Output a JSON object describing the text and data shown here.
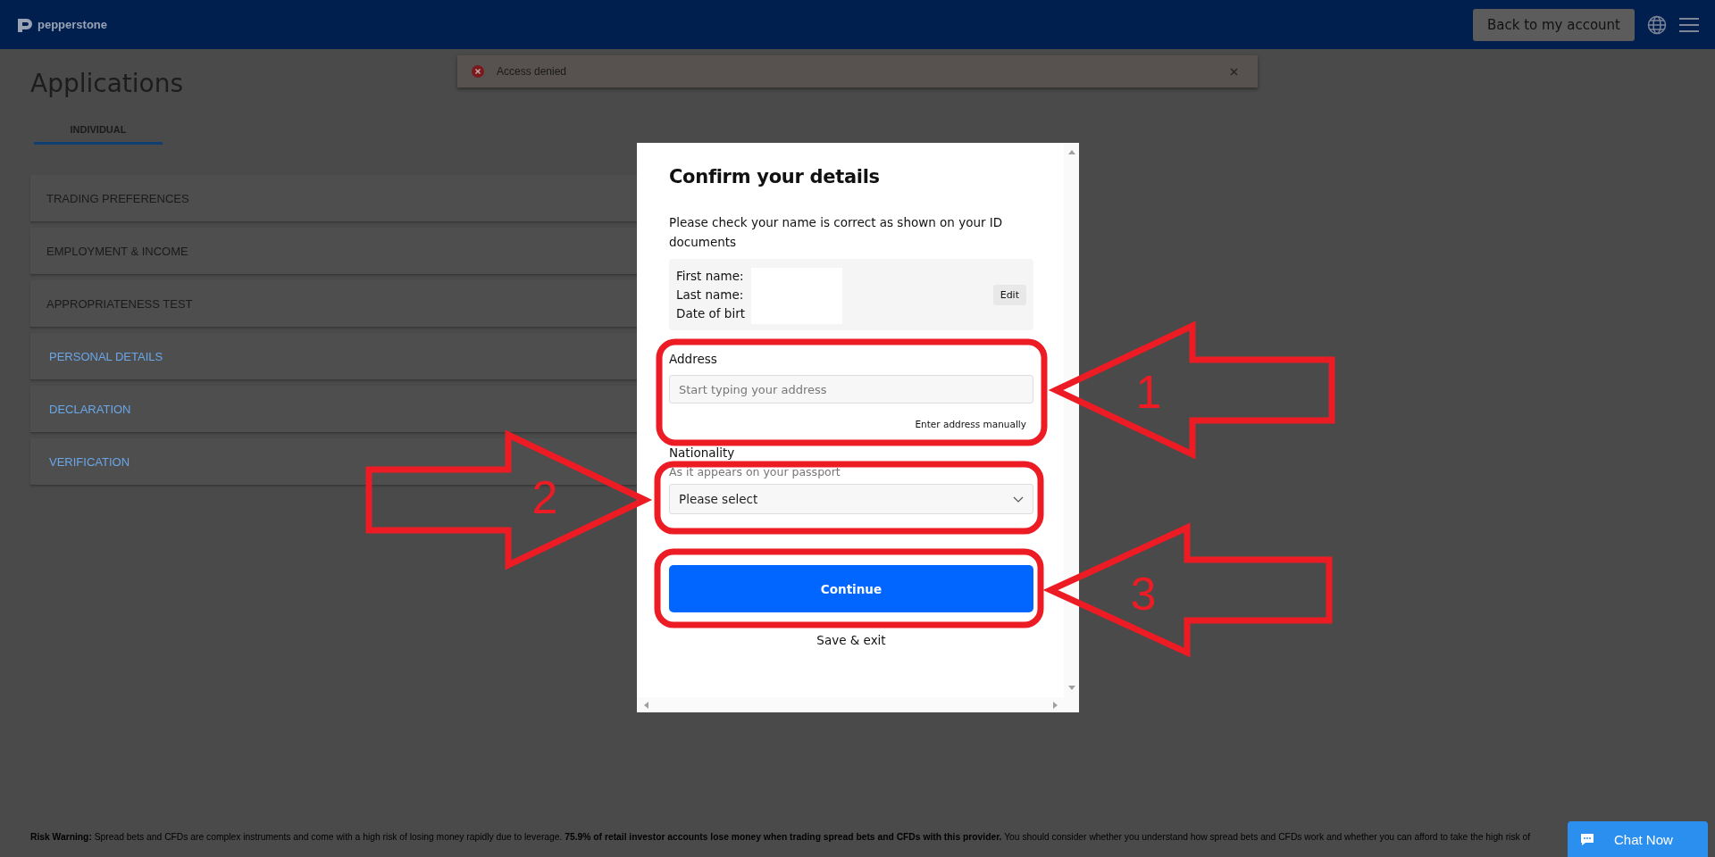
{
  "header": {
    "logo": "pepperstone",
    "back_button": "Back to my account"
  },
  "toast": {
    "message": "Access denied"
  },
  "page": {
    "title": "Applications",
    "tabs": [
      {
        "label": "INDIVIDUAL",
        "selected": true
      }
    ],
    "sections": [
      {
        "label": "TRADING PREFERENCES",
        "kind": "complete"
      },
      {
        "label": "EMPLOYMENT & INCOME",
        "kind": "complete"
      },
      {
        "label": "APPROPRIATENESS TEST",
        "kind": "complete"
      },
      {
        "label": "PERSONAL DETAILS",
        "kind": "pending"
      },
      {
        "label": "DECLARATION",
        "kind": "pending"
      },
      {
        "label": "VERIFICATION",
        "kind": "pending"
      }
    ]
  },
  "modal": {
    "title": "Confirm your details",
    "intro": "Please check your name is correct as shown on your ID documents",
    "name_card": {
      "fields": [
        "First name:",
        "Last name:",
        "Date of birt"
      ],
      "edit": "Edit"
    },
    "address": {
      "label": "Address",
      "placeholder": "Start typing your address",
      "manual_link": "Enter address manually"
    },
    "nationality": {
      "label": "Nationality",
      "hint": "As it appears on your passport",
      "value": "Please select"
    },
    "continue": "Continue",
    "save_exit": "Save & exit"
  },
  "annotations": [
    {
      "number": "1",
      "kind": "left"
    },
    {
      "number": "2",
      "kind": "right"
    },
    {
      "number": "3",
      "kind": "left"
    }
  ],
  "risk_warning": "**Risk Warning:** Spread bets and CFDs are complex instruments and come with a high risk of losing money rapidly due to leverage. **75.9% of retail investor accounts lose money when trading spread bets and CFDs with this provider.** You should consider whether you understand how spread bets and CFDs work and whether you can afford to take the high risk of",
  "chat_button": "Chat Now"
}
